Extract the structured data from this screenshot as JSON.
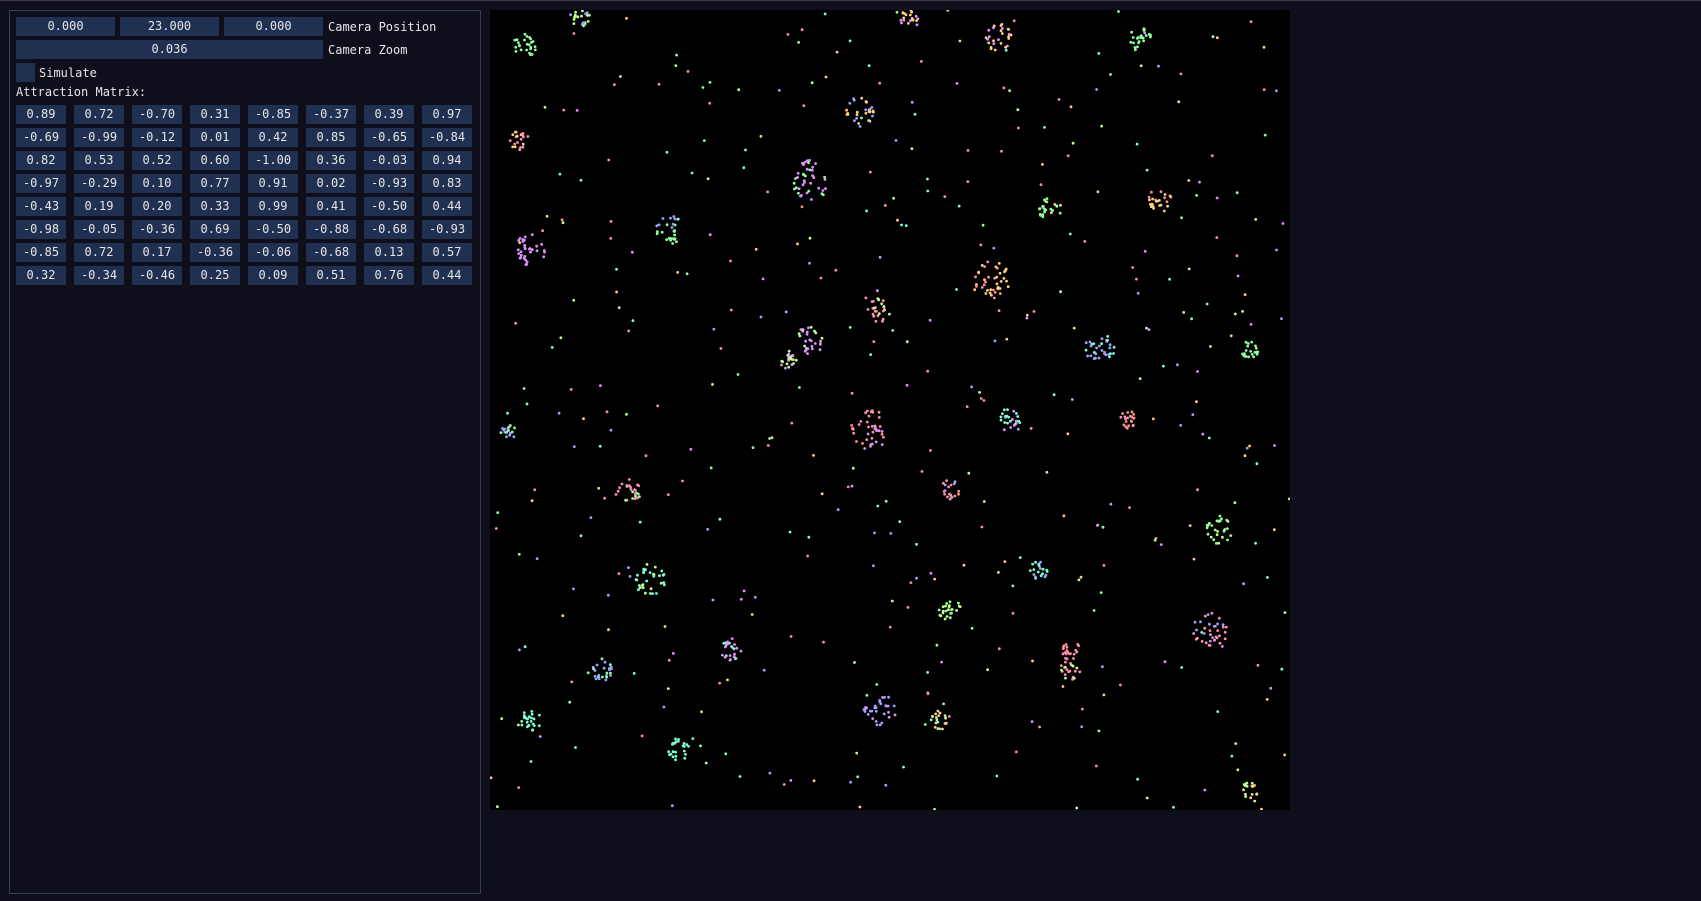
{
  "camera": {
    "position": [
      "0.000",
      "23.000",
      "0.000"
    ],
    "position_label": "Camera Position",
    "zoom": "0.036",
    "zoom_label": "Camera Zoom"
  },
  "simulate": {
    "label": "Simulate",
    "checked": false
  },
  "attraction_matrix": {
    "label": "Attraction Matrix:",
    "rows": [
      [
        "0.89",
        "0.72",
        "-0.70",
        "0.31",
        "-0.85",
        "-0.37",
        "0.39",
        "0.97"
      ],
      [
        "-0.69",
        "-0.99",
        "-0.12",
        "0.01",
        "0.42",
        "0.85",
        "-0.65",
        "-0.84"
      ],
      [
        "0.82",
        "0.53",
        "0.52",
        "0.60",
        "-1.00",
        "0.36",
        "-0.03",
        "0.94"
      ],
      [
        "-0.97",
        "-0.29",
        "0.10",
        "0.77",
        "0.91",
        "0.02",
        "-0.93",
        "0.83"
      ],
      [
        "-0.43",
        "0.19",
        "0.20",
        "0.33",
        "0.99",
        "0.41",
        "-0.50",
        "0.44"
      ],
      [
        "-0.98",
        "-0.05",
        "-0.36",
        "0.69",
        "-0.50",
        "-0.88",
        "-0.68",
        "-0.93"
      ],
      [
        "-0.85",
        "0.72",
        "0.17",
        "-0.36",
        "-0.06",
        "-0.68",
        "0.13",
        "0.57"
      ],
      [
        "0.32",
        "-0.34",
        "-0.46",
        "0.25",
        "0.09",
        "0.51",
        "0.76",
        "0.44"
      ]
    ]
  },
  "colors": {
    "panel_bg": "#0f0f1c",
    "field_bg": "#203050",
    "viewport_bg": "#000000",
    "particle_palette": [
      "#ff8fb0",
      "#7fffd4",
      "#c0ff8f",
      "#a0a0ff",
      "#ffd080",
      "#ff9090",
      "#e090ff",
      "#90ffa0"
    ]
  }
}
